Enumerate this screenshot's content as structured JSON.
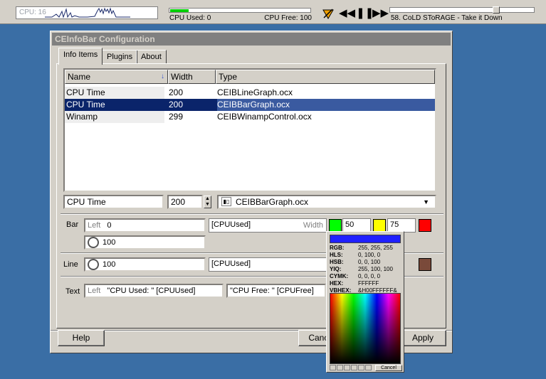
{
  "infobar": {
    "cpu_graph_label": "CPU: 16",
    "cpu_used": "CPU Used: 0",
    "cpu_free": "CPU Free: 100",
    "cpu_used_fraction": 0.13,
    "winamp": {
      "now_playing": "58. CoLD SToRAGE - Take it Down",
      "seek_fraction": 0.75,
      "icons": [
        "winamp-logo-icon",
        "previous-icon",
        "pause-icon",
        "next-icon"
      ]
    }
  },
  "dialog": {
    "title": "CEInfoBar Configuration",
    "tabs": [
      "Info Items",
      "Plugins",
      "About"
    ],
    "list": {
      "columns": [
        "Name",
        "Width",
        "Type"
      ],
      "rows": [
        {
          "name": "CPU Time",
          "width": "200",
          "type": "CEIBLineGraph.ocx"
        },
        {
          "name": "CPU Time",
          "width": "200",
          "type": "CEIBBarGraph.ocx"
        },
        {
          "name": "Winamp",
          "width": "299",
          "type": "CEIBWinampControl.ocx"
        }
      ],
      "selected_index": 1
    },
    "edit": {
      "name_value": "CPU Time",
      "width_value": "200",
      "type_value": "CEIBBarGraph.ocx"
    },
    "bar": {
      "label": "Bar",
      "left_label": "Left",
      "left_value": "0",
      "center_value": "[CPUUsed]",
      "width_label": "Width",
      "width_value": "50",
      "width2_value": "75",
      "interval_value": "100",
      "colors": [
        "#00ff00",
        "#ffff00",
        "#ff0000"
      ]
    },
    "line": {
      "label": "Line",
      "interval_value": "100",
      "center_value": "[CPUUsed]",
      "color": "#7a4a3a"
    },
    "text": {
      "label": "Text",
      "left_label": "Left",
      "left_value": "\"CPU Used: \" [CPUUsed]",
      "right_value": "\"CPU Free: \" [CPUFree]"
    },
    "buttons": {
      "help": "Help",
      "cancel": "Cancel",
      "apply": "Apply"
    }
  },
  "picker": {
    "rows": [
      {
        "k": "RGB:",
        "v": "255, 255, 255"
      },
      {
        "k": "HLS:",
        "v": "0, 100, 0"
      },
      {
        "k": "HSB:",
        "v": "0, 0, 100"
      },
      {
        "k": "YIQ:",
        "v": "255, 100, 100"
      },
      {
        "k": "CYMK:",
        "v": "0, 0, 0, 0"
      },
      {
        "k": "HEX:",
        "v": "FFFFFF"
      },
      {
        "k": "VBHEX:",
        "v": "&H00FFFFFF&"
      }
    ],
    "cancel": "Cancel",
    "current_color": "#2020ff"
  }
}
